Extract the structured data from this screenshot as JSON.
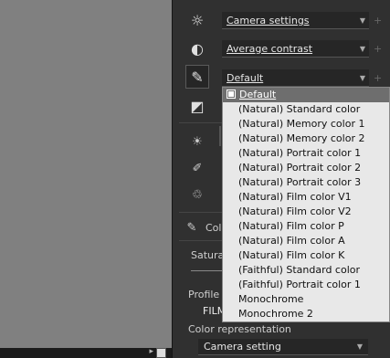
{
  "tools": {
    "camera_settings": "Camera settings",
    "contrast": "Average contrast",
    "color_mode": "Default"
  },
  "menu": {
    "selected": "Default",
    "items": [
      "(Natural) Standard color",
      "(Natural) Memory color 1",
      "(Natural) Memory color 2",
      "(Natural) Portrait color 1",
      "(Natural) Portrait color 2",
      "(Natural) Portrait color 3",
      "(Natural) Film color V1",
      "(Natural) Film color V2",
      "(Natural) Film color P",
      "(Natural) Film color A",
      "(Natural) Film color K",
      "(Faithful) Standard color",
      "(Faithful) Portrait color 1",
      "Monochrome",
      "Monochrome 2"
    ]
  },
  "panel": {
    "section_label": "Col",
    "saturation_label": "Satura",
    "profile_label": "Profile",
    "profile_value": "FILM",
    "color_representation_label": "Color representation",
    "color_representation_value": "Camera setting"
  }
}
